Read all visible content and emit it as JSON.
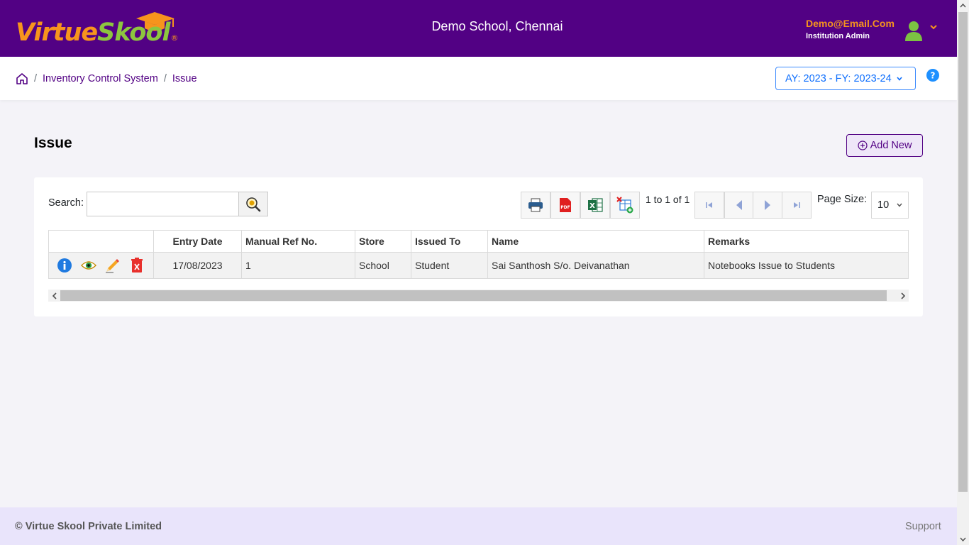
{
  "header": {
    "logo": {
      "part1": "Virtue",
      "part2": "Skool",
      "reg": "®"
    },
    "school_name": "Demo School, Chennai",
    "user_email": "Demo@Email.Com",
    "user_role": "Institution Admin"
  },
  "breadcrumb": {
    "items": [
      "Inventory Control System",
      "Issue"
    ],
    "separator": "/"
  },
  "academic_year": "AY: 2023 - FY: 2023-24",
  "page": {
    "title": "Issue",
    "add_new_label": "Add New"
  },
  "toolbar": {
    "search_label": "Search:",
    "search_value": "",
    "paging_summary": "1 to 1 of 1",
    "page_size_label": "Page Size:",
    "page_size_value": "10"
  },
  "grid": {
    "columns": [
      "",
      "Entry Date",
      "Manual Ref No.",
      "Store",
      "Issued To",
      "Name",
      "Remarks"
    ],
    "rows": [
      {
        "entry_date": "17/08/2023",
        "manual_ref_no": "1",
        "store": "School",
        "issued_to": "Student",
        "name": "Sai Santhosh S/o. Deivanathan",
        "remarks": "Notebooks Issue to Students"
      }
    ]
  },
  "footer": {
    "copyright": "© Virtue Skool Private Limited",
    "support": "Support"
  },
  "colors": {
    "brand_purple": "#520184",
    "brand_orange": "#f7941d",
    "brand_green": "#8dc63f",
    "accent_blue": "#0d6efd"
  }
}
